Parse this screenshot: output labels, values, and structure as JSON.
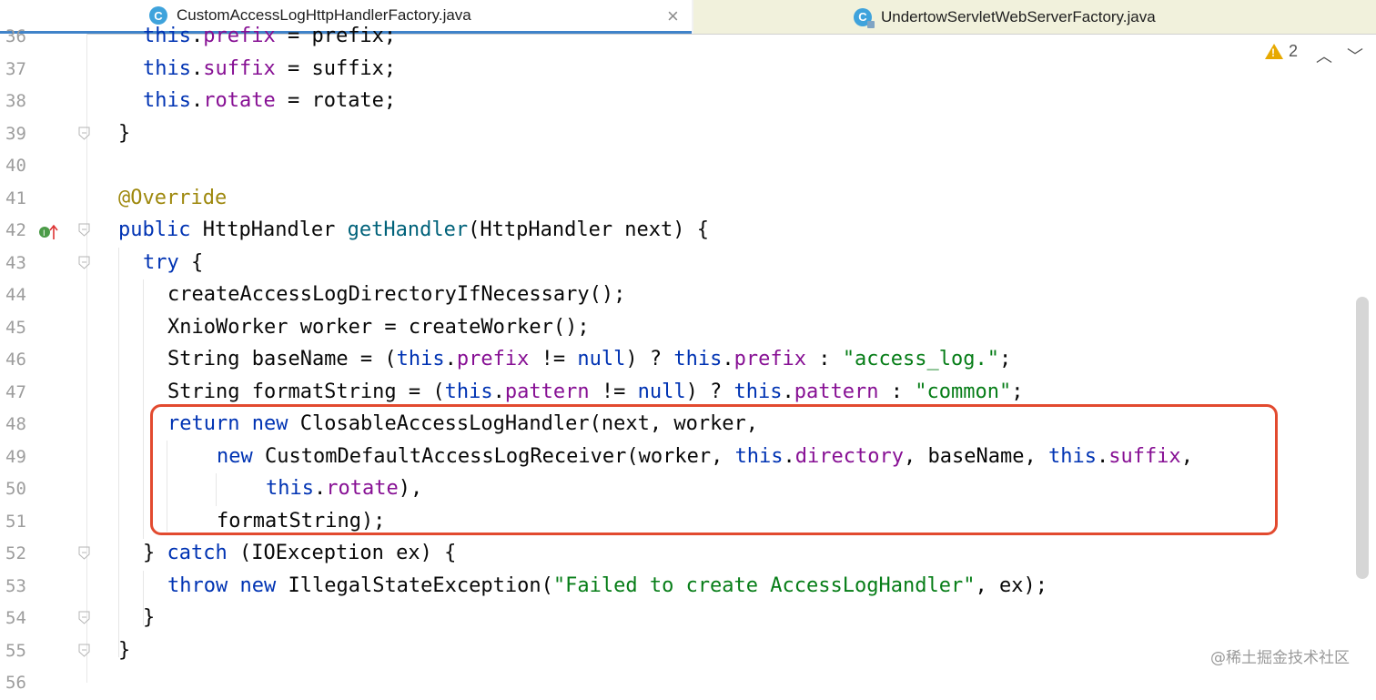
{
  "tabs": [
    {
      "label": "CustomAccessLogHttpHandlerFactory.java",
      "icon": "class-icon",
      "icon_letter": "C",
      "active": true
    },
    {
      "label": "UndertowServletWebServerFactory.java",
      "icon": "class-icon",
      "icon_letter": "C",
      "active": false
    }
  ],
  "inspections": {
    "warning_count": "2",
    "up": "⌃",
    "down": "⌄"
  },
  "lines": [
    {
      "num": "36"
    },
    {
      "num": "37"
    },
    {
      "num": "38"
    },
    {
      "num": "39"
    },
    {
      "num": "40"
    },
    {
      "num": "41"
    },
    {
      "num": "42"
    },
    {
      "num": "43"
    },
    {
      "num": "44"
    },
    {
      "num": "45"
    },
    {
      "num": "46"
    },
    {
      "num": "47"
    },
    {
      "num": "48"
    },
    {
      "num": "49"
    },
    {
      "num": "50"
    },
    {
      "num": "51"
    },
    {
      "num": "52"
    },
    {
      "num": "53"
    },
    {
      "num": "54"
    },
    {
      "num": "55"
    },
    {
      "num": "56"
    }
  ],
  "code": {
    "l36": [
      "this",
      ".",
      "prefix",
      " = prefix;"
    ],
    "l37": [
      "this",
      ".",
      "suffix",
      " = suffix;"
    ],
    "l38": [
      "this",
      ".",
      "rotate",
      " = rotate;"
    ],
    "l39": "}",
    "l41": "@Override",
    "l42": [
      "public",
      " HttpHandler ",
      "getHandler",
      "(HttpHandler next) {"
    ],
    "l43": [
      "try",
      " {"
    ],
    "l44": "createAccessLogDirectoryIfNecessary();",
    "l45": "XnioWorker worker = createWorker();",
    "l46": [
      "String baseName = (",
      "this",
      ".",
      "prefix",
      " != ",
      "null",
      ") ? ",
      "this",
      ".",
      "prefix",
      " : ",
      "\"access_log.\"",
      ";"
    ],
    "l47": [
      "String formatString = (",
      "this",
      ".",
      "pattern",
      " != ",
      "null",
      ") ? ",
      "this",
      ".",
      "pattern",
      " : ",
      "\"common\"",
      ";"
    ],
    "l48": [
      "return",
      " ",
      "new",
      " ClosableAccessLogHandler(next, worker,"
    ],
    "l49": [
      "new",
      " CustomDefaultAccessLogReceiver(worker, ",
      "this",
      ".",
      "directory",
      ", baseName, ",
      "this",
      ".",
      "suffix",
      ","
    ],
    "l50": [
      "this",
      ".",
      "rotate",
      "),"
    ],
    "l51": "formatString);",
    "l52": [
      "} ",
      "catch",
      " (IOException ex) {"
    ],
    "l53": [
      "throw",
      " ",
      "new",
      " IllegalStateException(",
      "\"Failed to create AccessLogHandler\"",
      ", ex);"
    ],
    "l54": "}",
    "l55": "}"
  },
  "watermark": "@稀土掘金技术社区"
}
